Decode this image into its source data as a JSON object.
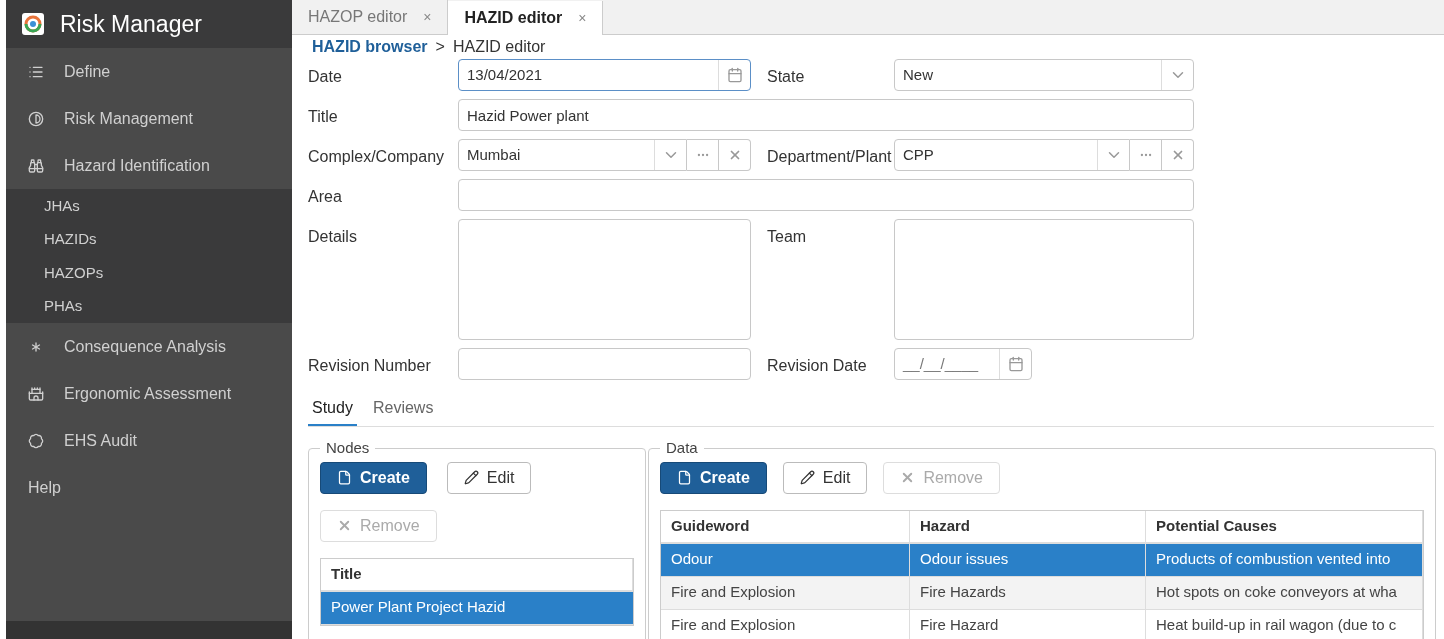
{
  "app": {
    "title": "Risk Manager"
  },
  "sidebar": {
    "items": [
      {
        "label": "Define"
      },
      {
        "label": "Risk Management"
      },
      {
        "label": "Hazard Identification",
        "expanded": true,
        "children": [
          {
            "label": "JHAs"
          },
          {
            "label": "HAZIDs"
          },
          {
            "label": "HAZOPs"
          },
          {
            "label": "PHAs"
          }
        ]
      },
      {
        "label": "Consequence Analysis"
      },
      {
        "label": "Ergonomic Assessment"
      },
      {
        "label": "EHS Audit"
      },
      {
        "label": "Help"
      }
    ]
  },
  "tabs": [
    {
      "label": "HAZOP editor",
      "selected": false,
      "close": "×"
    },
    {
      "label": "HAZID editor",
      "selected": true,
      "close": "×"
    }
  ],
  "breadcrumb": {
    "link": "HAZID browser",
    "separator": ">",
    "current": "HAZID editor"
  },
  "form": {
    "rows": [
      [
        {
          "label": "Date",
          "kind": "date",
          "value": "13/04/2021",
          "focused": true
        },
        {
          "label": "State",
          "kind": "select",
          "value": "New",
          "focused": false
        }
      ],
      [
        {
          "label": "Title",
          "kind": "text",
          "value": "Hazid Power plant",
          "focused": false
        }
      ],
      [
        {
          "label": "Complex/Company",
          "kind": "lookup",
          "value": "Mumbai",
          "focused": false
        },
        {
          "label": "Department/Plant",
          "kind": "lookup",
          "value": "CPP",
          "focused": false
        }
      ],
      [
        {
          "label": "Area",
          "kind": "text",
          "focused": false
        }
      ],
      [
        {
          "label": "Details",
          "kind": "textarea",
          "focused": false
        },
        {
          "label": "Team",
          "kind": "textarea",
          "focused": false
        }
      ],
      [
        {
          "label": "Revision Number",
          "kind": "text",
          "focused": false
        },
        {
          "label": "Revision Date",
          "kind": "date",
          "placeholder": "__/__/____",
          "focused": false
        }
      ]
    ]
  },
  "section_tabs": [
    {
      "label": "Study",
      "selected": true
    },
    {
      "label": "Reviews",
      "selected": false
    }
  ],
  "nodes": {
    "legend": "Nodes",
    "buttons": [
      {
        "label": "Create",
        "kind": "primary",
        "disabled": false
      },
      {
        "label": "Edit",
        "kind": "edit",
        "disabled": false
      },
      {
        "label": "Remove",
        "kind": "remove",
        "disabled": true
      }
    ],
    "columns": [
      "Title"
    ],
    "rows": [
      {
        "cells": [
          "Power Plant Project Hazid"
        ],
        "selected": true
      }
    ]
  },
  "data": {
    "legend": "Data",
    "buttons": [
      {
        "label": "Create",
        "kind": "primary",
        "disabled": false
      },
      {
        "label": "Edit",
        "kind": "edit",
        "disabled": false
      },
      {
        "label": "Remove",
        "kind": "remove",
        "disabled": true
      }
    ],
    "columns": [
      "Guideword",
      "Hazard",
      "Potential Causes"
    ],
    "rows": [
      {
        "cells": [
          "Odour",
          "Odour issues",
          "Products of combustion vented into"
        ],
        "selected": true
      },
      {
        "cells": [
          "Fire and Explosion",
          "Fire Hazards",
          "Hot spots on coke conveyors at wha"
        ],
        "selected": false
      },
      {
        "cells": [
          "Fire and Explosion",
          "Fire Hazard",
          "Heat build-up in rail wagon (due to c"
        ],
        "selected": false
      }
    ]
  }
}
